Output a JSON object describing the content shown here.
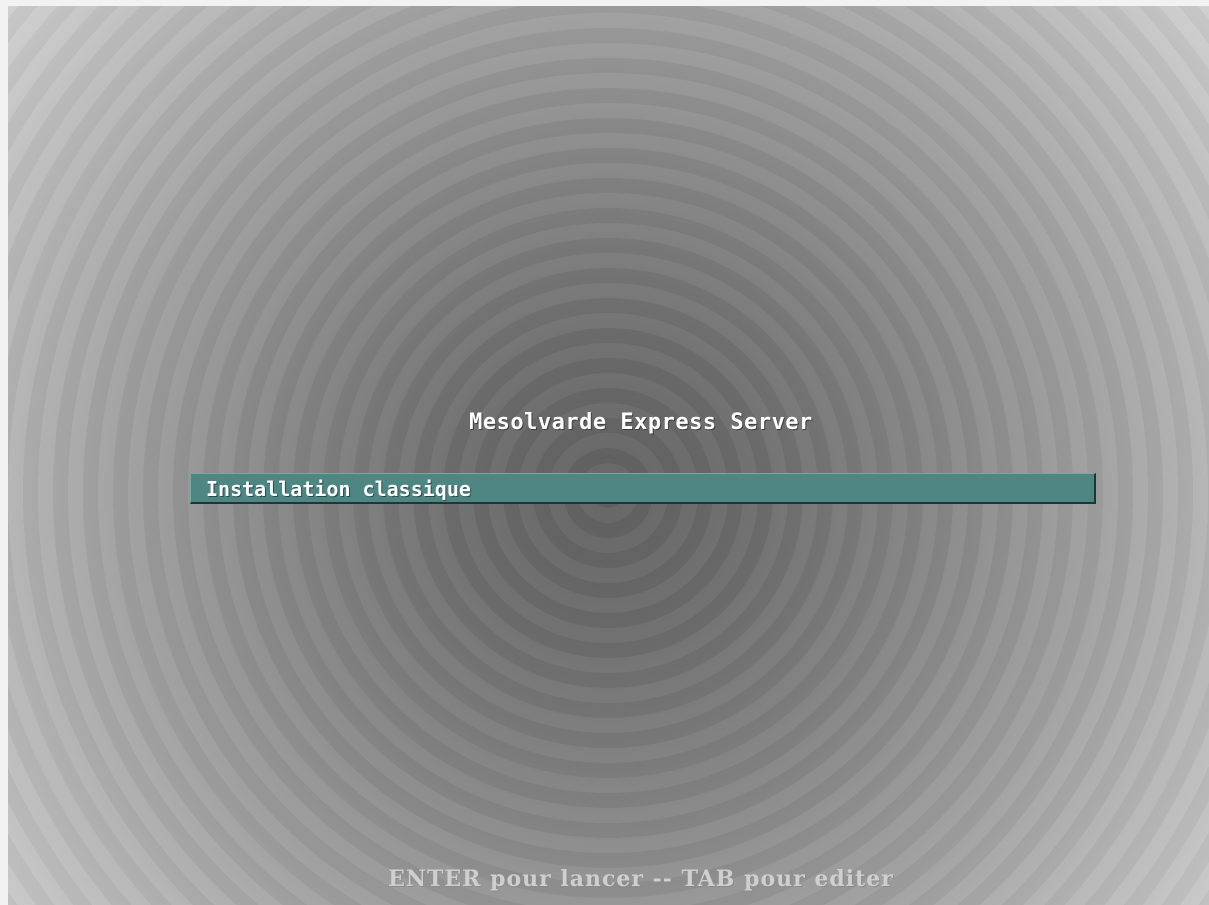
{
  "menu": {
    "title": "Mesolvarde Express Server",
    "items": [
      {
        "label": "Installation classique",
        "selected": true
      }
    ]
  },
  "help": {
    "text": "ENTER pour lancer -- TAB pour editer"
  },
  "colors": {
    "selection_bar": "#4e8684",
    "menu_text": "#ffffff",
    "help_text": "#cfcfcf",
    "background_center": "#626262",
    "background_edge": "#d3d3d3"
  }
}
